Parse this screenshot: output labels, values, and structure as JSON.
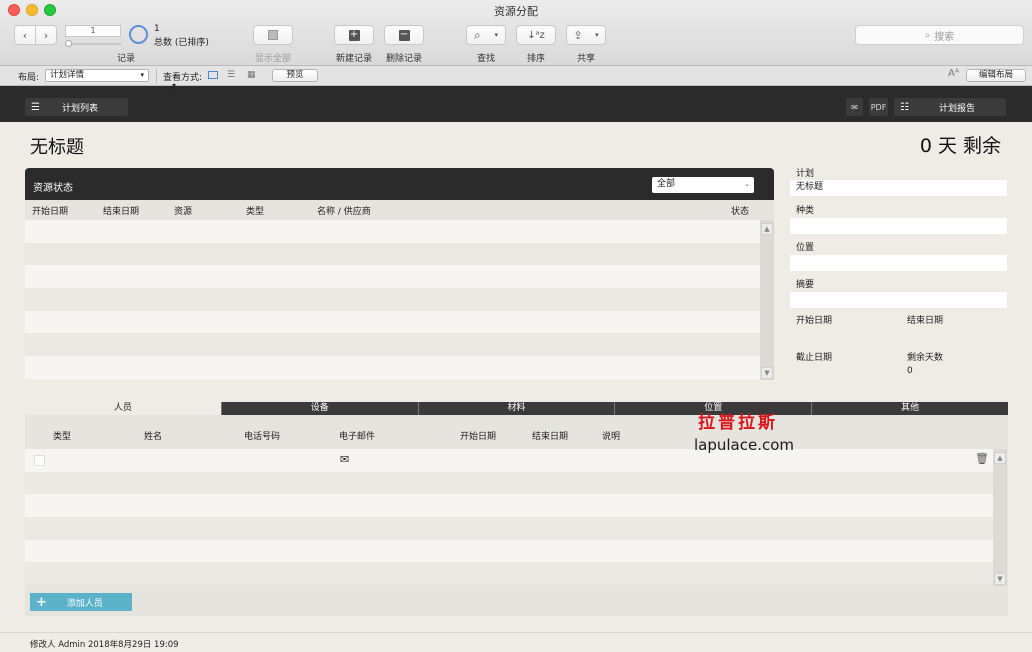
{
  "window": {
    "title": "资源分配"
  },
  "toolbar": {
    "record_index": "1",
    "total_count": "1",
    "total_label": "总数 (已排序)",
    "records_label": "记录",
    "show_all": "显示全部",
    "new_record": "新建记录",
    "delete_record": "删除记录",
    "find": "查找",
    "sort": "排序",
    "share": "共享",
    "search_placeholder": "搜索"
  },
  "layoutbar": {
    "layout_label": "布局:",
    "layout_value": "计划详情",
    "view_label": "查看方式:",
    "preview": "预览",
    "edit_layout": "编辑布局"
  },
  "header": {
    "plan_list": "计划列表",
    "pdf": "PDF",
    "plan_report": "计划报告"
  },
  "main": {
    "title": "无标题",
    "days_left": "0 天 剩余"
  },
  "resource_panel": {
    "title": "资源状态",
    "filter_value": "全部",
    "columns": [
      "开始日期",
      "结束日期",
      "资源",
      "类型",
      "名称 / 供应商",
      "状态"
    ]
  },
  "details": {
    "plan_label": "计划",
    "plan_value": "无标题",
    "category_label": "种类",
    "location_label": "位置",
    "summary_label": "摘要",
    "start_label": "开始日期",
    "end_label": "结束日期",
    "deadline_label": "截止日期",
    "remaining_label": "剩余天数",
    "remaining_value": "0"
  },
  "tabs": [
    "人员",
    "设备",
    "材料",
    "位置",
    "其他"
  ],
  "people": {
    "columns": [
      "类型",
      "姓名",
      "电话号码",
      "电子邮件",
      "开始日期",
      "结束日期",
      "说明"
    ],
    "add_button": "添加人员"
  },
  "footer": {
    "modified": "修改人 Admin 2018年8月29日  19:09"
  },
  "watermark": {
    "cn": "拉普拉斯",
    "en": "lapulace.com"
  }
}
